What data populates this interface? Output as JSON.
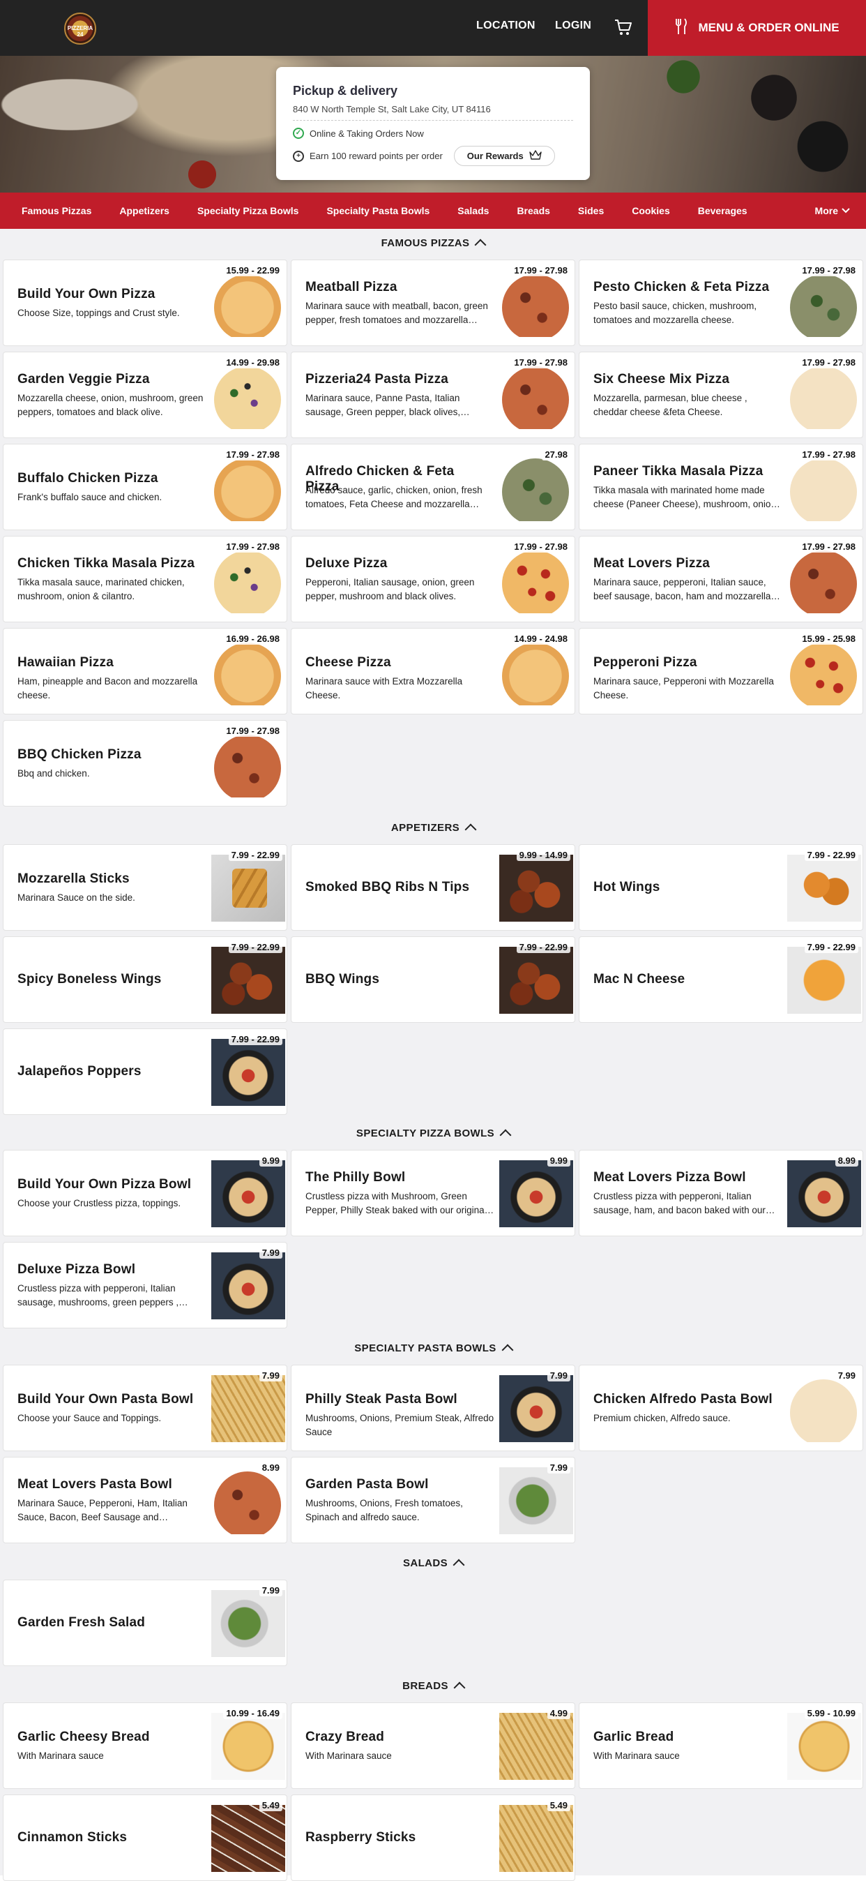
{
  "header": {
    "logo_text": "PIZZERIA 24",
    "nav": {
      "location": "LOCATION",
      "login": "LOGIN"
    },
    "order_button": "MENU & ORDER ONLINE"
  },
  "info": {
    "title": "Pickup & delivery",
    "address": "840 W North Temple St, Salt Lake City, UT 84116",
    "status": "Online & Taking Orders Now",
    "reward_text": "Earn 100 reward points per order",
    "rewards_button": "Our Rewards"
  },
  "categories": [
    "Famous Pizzas",
    "Appetizers",
    "Specialty Pizza Bowls",
    "Specialty Pasta Bowls",
    "Salads",
    "Breads",
    "Sides",
    "Cookies",
    "Beverages"
  ],
  "more_label": "More",
  "sections": {
    "famous": {
      "title": "FAMOUS PIZZAS",
      "items": [
        {
          "name": "Build Your Own Pizza",
          "desc": "Choose Size, toppings and Crust style.",
          "price": "15.99 - 22.99"
        },
        {
          "name": "Meatball Pizza",
          "desc": "Marinara sauce with meatball, bacon, green pepper, fresh tomatoes and mozzarella cheese.",
          "price": "17.99 - 27.98"
        },
        {
          "name": "Pesto Chicken & Feta Pizza",
          "desc": "Pesto basil sauce, chicken, mushroom, tomatoes and mozzarella cheese.",
          "price": "17.99 - 27.98"
        },
        {
          "name": "Garden Veggie Pizza",
          "desc": "Mozzarella cheese, onion, mushroom, green peppers, tomatoes and black olive.",
          "price": "14.99 - 29.98"
        },
        {
          "name": "Pizzeria24 Pasta Pizza",
          "desc": "Marinara sauce, Panne Pasta, Italian sausage, Green pepper, black olives, mozzarella cheese.",
          "price": "17.99 - 27.98"
        },
        {
          "name": "Six Cheese Mix Pizza",
          "desc": "Mozzarella, parmesan, blue cheese , cheddar cheese &feta Cheese.",
          "price": "17.99 - 27.98"
        },
        {
          "name": "Buffalo Chicken Pizza",
          "desc": "Frank's buffalo sauce and chicken.",
          "price": "17.99 - 27.98"
        },
        {
          "name": "Alfredo Chicken & Feta Pizza",
          "desc": "Alfredo sauce, garlic, chicken, onion, fresh tomatoes, Feta Cheese and mozzarella cheese.",
          "price": "27.98"
        },
        {
          "name": "Paneer Tikka Masala Pizza",
          "desc": "Tikka masala with marinated home made cheese (Paneer Cheese), mushroom, onion and cilantro.",
          "price": "17.99 - 27.98"
        },
        {
          "name": "Chicken Tikka Masala Pizza",
          "desc": "Tikka masala sauce, marinated chicken, mushroom, onion & cilantro.",
          "price": "17.99 - 27.98"
        },
        {
          "name": "Deluxe Pizza",
          "desc": "Pepperoni, Italian sausage, onion, green pepper, mushroom and black olives.",
          "price": "17.99 - 27.98"
        },
        {
          "name": "Meat Lovers Pizza",
          "desc": "Marinara sauce, pepperoni, Italian sauce, beef sausage, bacon, ham and mozzarella cheese.",
          "price": "17.99 - 27.98"
        },
        {
          "name": "Hawaiian Pizza",
          "desc": "Ham, pineapple and Bacon and mozzarella cheese.",
          "price": "16.99 - 26.98"
        },
        {
          "name": "Cheese Pizza",
          "desc": "Marinara sauce with Extra Mozzarella Cheese.",
          "price": "14.99 - 24.98"
        },
        {
          "name": "Pepperoni Pizza",
          "desc": "Marinara sauce, Pepperoni with Mozzarella Cheese.",
          "price": "15.99 - 25.98"
        },
        {
          "name": "BBQ Chicken Pizza",
          "desc": "Bbq and chicken.",
          "price": "17.99 - 27.98"
        }
      ]
    },
    "appetizers": {
      "title": "APPETIZERS",
      "items": [
        {
          "name": "Mozzarella Sticks",
          "desc": "Marinara Sauce on the side.",
          "price": "7.99 - 22.99"
        },
        {
          "name": "Smoked BBQ Ribs N Tips",
          "desc": "",
          "price": "9.99 - 14.99"
        },
        {
          "name": "Hot Wings",
          "desc": "",
          "price": "7.99 - 22.99"
        },
        {
          "name": "Spicy Boneless Wings",
          "desc": "",
          "price": "7.99 - 22.99"
        },
        {
          "name": "BBQ Wings",
          "desc": "",
          "price": "7.99 - 22.99"
        },
        {
          "name": "Mac N Cheese",
          "desc": "",
          "price": "7.99 - 22.99"
        },
        {
          "name": "Jalapeños Poppers",
          "desc": "",
          "price": "7.99 - 22.99"
        }
      ]
    },
    "pizza_bowls": {
      "title": "SPECIALTY PIZZA BOWLS",
      "items": [
        {
          "name": "Build Your Own Pizza Bowl",
          "desc": "Choose your Crustless pizza, toppings.",
          "price": "9.99"
        },
        {
          "name": "The Philly Bowl",
          "desc": "Crustless pizza with Mushroom, Green Pepper, Philly Steak baked with our original sauce.",
          "price": "9.99"
        },
        {
          "name": "Meat Lovers Pizza Bowl",
          "desc": "Crustless pizza with pepperoni, Italian sausage, ham, and bacon baked with our original sauce.",
          "price": "8.99"
        },
        {
          "name": "Deluxe Pizza Bowl",
          "desc": "Crustless pizza with pepperoni, Italian sausage, mushrooms, green peppers , onions.",
          "price": "7.99"
        }
      ]
    },
    "pasta_bowls": {
      "title": "SPECIALTY PASTA BOWLS",
      "items": [
        {
          "name": "Build Your Own Pasta Bowl",
          "desc": "Choose your Sauce and Toppings.",
          "price": "7.99"
        },
        {
          "name": "Philly Steak Pasta Bowl",
          "desc": "Mushrooms, Onions, Premium Steak, Alfredo Sauce",
          "price": "7.99"
        },
        {
          "name": "Chicken Alfredo Pasta Bowl",
          "desc": "Premium chicken, Alfredo sauce.",
          "price": "7.99"
        },
        {
          "name": "Meat Lovers Pasta Bowl",
          "desc": "Marinara Sauce, Pepperoni, Ham, Italian Sauce, Bacon, Beef Sausage and Mozzarella.",
          "price": "8.99"
        },
        {
          "name": "Garden Pasta Bowl",
          "desc": "Mushrooms, Onions, Fresh tomatoes, Spinach and alfredo sauce.",
          "price": "7.99"
        }
      ]
    },
    "salads": {
      "title": "SALADS",
      "items": [
        {
          "name": "Garden Fresh Salad",
          "desc": "",
          "price": "7.99"
        }
      ]
    },
    "breads": {
      "title": "BREADS",
      "items": [
        {
          "name": "Garlic Cheesy Bread",
          "desc": "With Marinara sauce",
          "price": "10.99 - 16.49"
        },
        {
          "name": "Crazy Bread",
          "desc": "With Marinara sauce",
          "price": "4.99"
        },
        {
          "name": "Garlic Bread",
          "desc": "With Marinara sauce",
          "price": "5.99 - 10.99"
        },
        {
          "name": "Cinnamon Sticks",
          "desc": "",
          "price": "5.49"
        },
        {
          "name": "Raspberry Sticks",
          "desc": "",
          "price": "5.49"
        }
      ]
    }
  },
  "colors": {
    "brand_red": "#c01d2a",
    "topbar": "#232323",
    "section_bg": "#f1f1f3",
    "status_green": "#2fa84f"
  },
  "icons": [
    "cart-icon",
    "utensils-icon",
    "check-circle-icon",
    "plus-circle-icon",
    "crown-icon",
    "chevron-down-icon",
    "chevron-up-icon"
  ]
}
